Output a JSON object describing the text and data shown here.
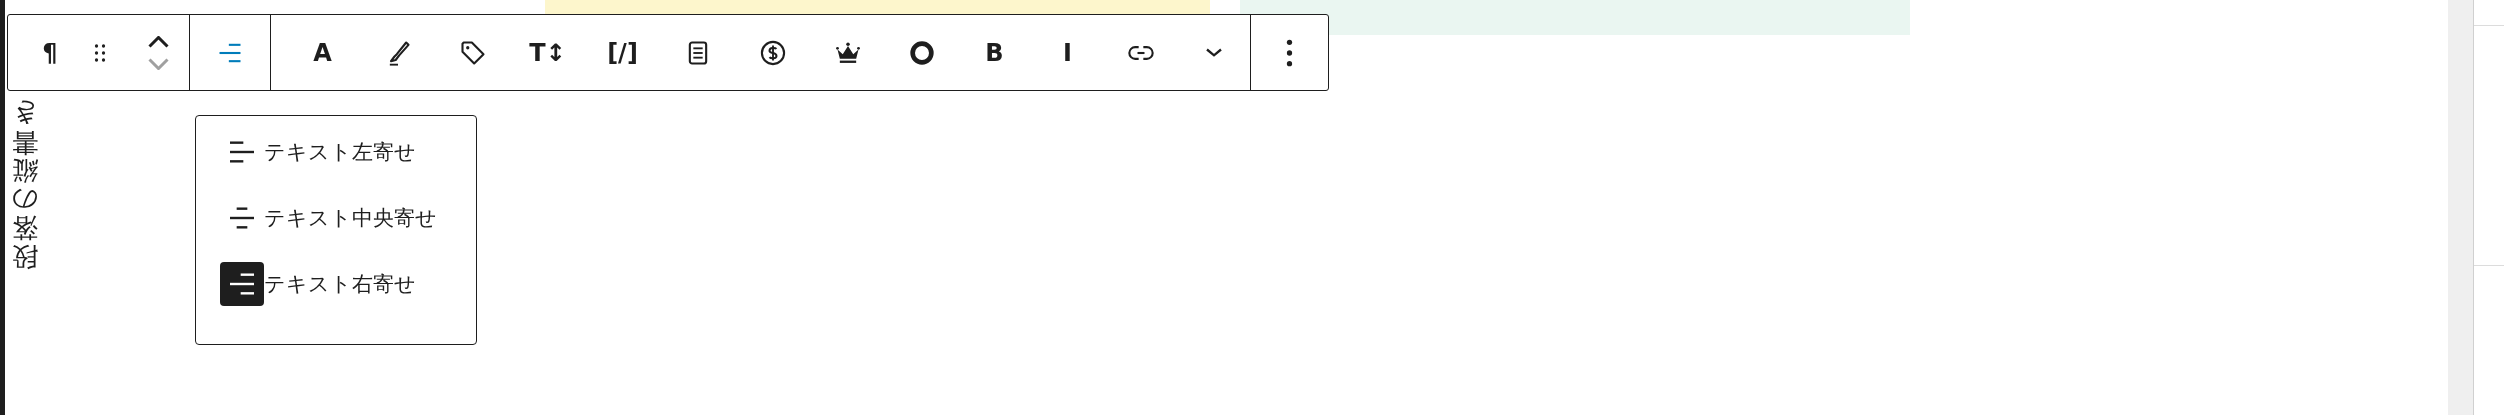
{
  "toolbar": {
    "groups": [
      {
        "items": [
          {
            "kind": "glyph",
            "label": "¶"
          },
          {
            "kind": "drag"
          },
          {
            "kind": "mover"
          }
        ]
      },
      {
        "items": [
          {
            "kind": "align",
            "expanded": true
          }
        ]
      },
      {
        "items": [
          {
            "kind": "glyph",
            "label": "A"
          },
          {
            "kind": "brush"
          },
          {
            "kind": "tag"
          },
          {
            "kind": "glyph",
            "label": "T↕"
          },
          {
            "kind": "glyph",
            "label": "[/]"
          },
          {
            "kind": "document"
          },
          {
            "kind": "dollar"
          },
          {
            "kind": "crown"
          },
          {
            "kind": "ring"
          },
          {
            "kind": "glyph",
            "label": "B"
          },
          {
            "kind": "glyph",
            "label": "I"
          },
          {
            "kind": "link"
          },
          {
            "kind": "chevron"
          }
        ]
      },
      {
        "items": [
          {
            "kind": "more"
          }
        ]
      }
    ]
  },
  "align_menu": [
    {
      "kind": "left",
      "label": "テキスト左寄せ",
      "selected": false
    },
    {
      "kind": "center",
      "label": "テキスト中央寄せ",
      "selected": false
    },
    {
      "kind": "right",
      "label": "テキスト右寄せ",
      "selected": true
    }
  ],
  "vertical_text": "段落の縦書き"
}
